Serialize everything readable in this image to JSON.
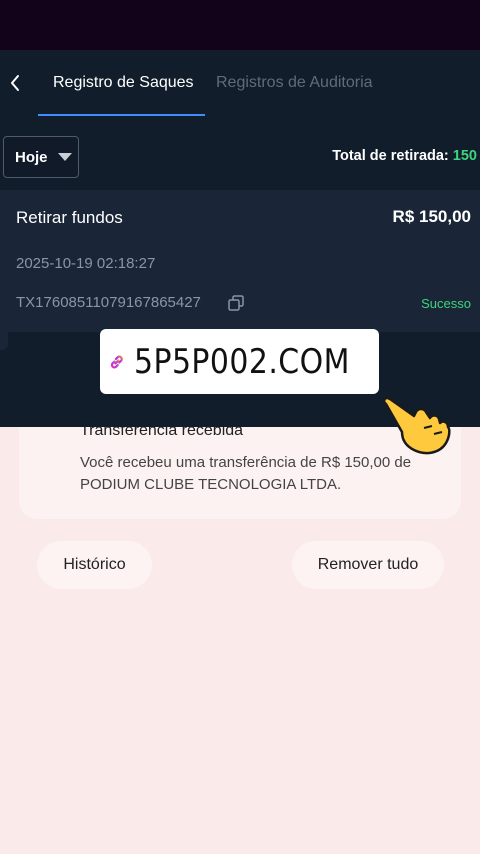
{
  "header": {
    "tabs": [
      {
        "label": "Registro de Saques",
        "active": true
      },
      {
        "label": "Registros de Auditoria",
        "active": false
      }
    ]
  },
  "filter": {
    "date_selected": "Hoje",
    "total_label": "Total de retirada:",
    "total_value": "150"
  },
  "record": {
    "title": "Retirar fundos",
    "amount": "R$ 150,00",
    "datetime": "2025-10-19 02:18:27",
    "tx_id": "TX17608511079167865427",
    "status": "Sucesso"
  },
  "notification": {
    "title": "Transferência recebida",
    "body": "Você recebeu uma transferência de R$ 150,00 de PODIUM CLUBE TECNOLOGIA LTDA."
  },
  "actions": {
    "history_label": "Histórico",
    "clear_label": "Remover tudo"
  },
  "banner": {
    "text": "5P5P002.COM",
    "icon": "link-icon"
  },
  "colors": {
    "accent": "#3f8bff",
    "success": "#3fd27f",
    "app_bg": "#121d2c",
    "card_bg": "#1a2637"
  }
}
